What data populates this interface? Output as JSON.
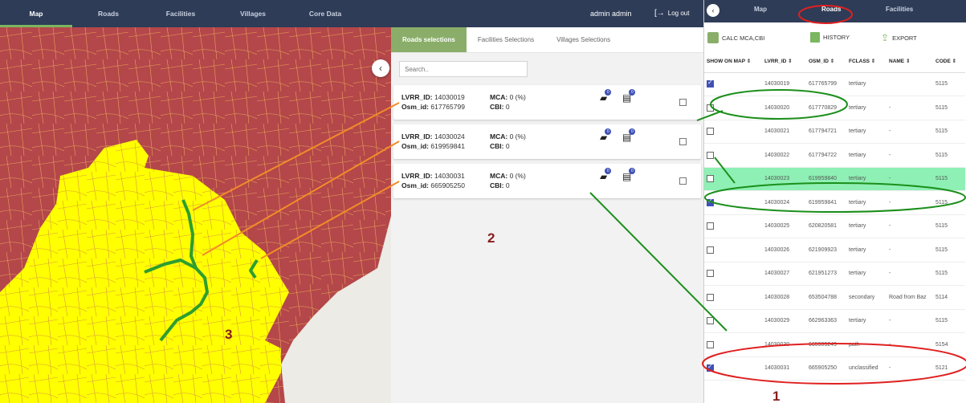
{
  "nav": {
    "items": [
      "Map",
      "Roads",
      "Facilities",
      "Villages",
      "Core Data"
    ],
    "active": "Map",
    "user": "admin admin",
    "logout": "Log out"
  },
  "panel": {
    "tabs": [
      "Roads selections",
      "Facilities Selections",
      "Villages Selections"
    ],
    "search_placeholder": "Search..",
    "cards": [
      {
        "lvrr_label": "LVRR_ID:",
        "lvrr": "14030019",
        "osm_label": "Osm_id:",
        "osm": "617765799",
        "mca_label": "MCA:",
        "mca": "0 (%)",
        "cbi_label": "CBI:",
        "cbi": "0",
        "badge1": "0",
        "badge2": "0"
      },
      {
        "lvrr_label": "LVRR_ID:",
        "lvrr": "14030024",
        "osm_label": "Osm_id:",
        "osm": "619959841",
        "mca_label": "MCA:",
        "mca": "0 (%)",
        "cbi_label": "CBI:",
        "cbi": "0",
        "badge1": "0",
        "badge2": "0"
      },
      {
        "lvrr_label": "LVRR_ID:",
        "lvrr": "14030031",
        "osm_label": "Osm_id:",
        "osm": "665905250",
        "mca_label": "MCA:",
        "mca": "0 (%)",
        "cbi_label": "CBI:",
        "cbi": "0",
        "badge1": "0",
        "badge2": "0"
      }
    ]
  },
  "labels": {
    "one": "1",
    "two": "2",
    "three": "3"
  },
  "right": {
    "nav": [
      "Map",
      "Roads",
      "Facilities"
    ],
    "toolbar": {
      "calc": "CALC MCA,CBI",
      "history": "HISTORY",
      "export": "EXPORT"
    },
    "columns": [
      "SHOW ON MAP ⇕",
      "LVRR_ID ⇕",
      "OSM_ID ⇕",
      "FCLASS ⇕",
      "NAME ⇕",
      "CODE ⇕"
    ],
    "rows": [
      {
        "checked": true,
        "lvrr": "14030019",
        "osm": "617765799",
        "fclass": "tertiary",
        "name": "",
        "code": "5115"
      },
      {
        "checked": false,
        "lvrr": "14030020",
        "osm": "617770829",
        "fclass": "tertiary",
        "name": "-",
        "code": "5115"
      },
      {
        "checked": false,
        "lvrr": "14030021",
        "osm": "617794721",
        "fclass": "tertiary",
        "name": "-",
        "code": "5115"
      },
      {
        "checked": false,
        "lvrr": "14030022",
        "osm": "617794722",
        "fclass": "tertiary",
        "name": "-",
        "code": "5115"
      },
      {
        "checked": false,
        "lvrr": "14030023",
        "osm": "619959840",
        "fclass": "tertiary",
        "name": "-",
        "code": "5115",
        "highlight": true
      },
      {
        "checked": true,
        "lvrr": "14030024",
        "osm": "619959841",
        "fclass": "tertiary",
        "name": "-",
        "code": "5115"
      },
      {
        "checked": false,
        "lvrr": "14030025",
        "osm": "620820581",
        "fclass": "tertiary",
        "name": "-",
        "code": "5115"
      },
      {
        "checked": false,
        "lvrr": "14030026",
        "osm": "621909923",
        "fclass": "tertiary",
        "name": "-",
        "code": "5115"
      },
      {
        "checked": false,
        "lvrr": "14030027",
        "osm": "621951273",
        "fclass": "tertiary",
        "name": "-",
        "code": "5115"
      },
      {
        "checked": false,
        "lvrr": "14030028",
        "osm": "653504788",
        "fclass": "secondary",
        "name": "Road from Baz",
        "code": "5114"
      },
      {
        "checked": false,
        "lvrr": "14030029",
        "osm": "662963363",
        "fclass": "tertiary",
        "name": "-",
        "code": "5115"
      },
      {
        "checked": false,
        "lvrr": "14030030",
        "osm": "665905249",
        "fclass": "path",
        "name": "-",
        "code": "5154"
      },
      {
        "checked": true,
        "lvrr": "14030031",
        "osm": "665905250",
        "fclass": "unclassified",
        "name": "-",
        "code": "5121"
      }
    ]
  },
  "colors": {
    "nav_bg": "#2e3c57",
    "accent": "#8aae6a",
    "region_red": "#b4474a",
    "region_yellow": "#ffff00",
    "road_green": "#2e9e2e",
    "annot_orange": "#f28c28",
    "annot_red": "#e02020",
    "annot_green": "#1b8f1b"
  }
}
